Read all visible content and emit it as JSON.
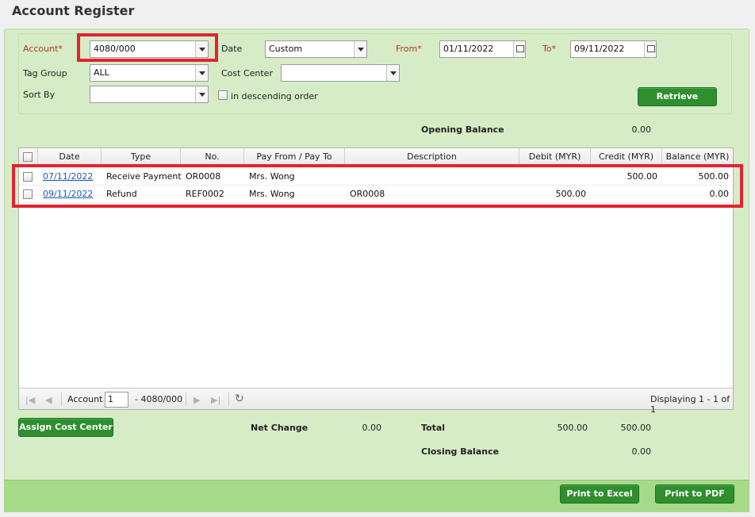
{
  "page": {
    "title": "Account Register"
  },
  "filters": {
    "account_label": "Account*",
    "account_value": "4080/000",
    "date_label": "Date",
    "date_value": "Custom",
    "from_label": "From*",
    "from_value": "01/11/2022",
    "to_label": "To*",
    "to_value": "09/11/2022",
    "tag_group_label": "Tag Group",
    "tag_group_value": "ALL",
    "cost_center_label": "Cost Center",
    "cost_center_value": "",
    "sort_by_label": "Sort By",
    "sort_by_value": "",
    "descending_label": "in descending order",
    "retrieve_label": "Retrieve"
  },
  "opening": {
    "label": "Opening Balance",
    "value": "0.00"
  },
  "table": {
    "headers": [
      "Date",
      "Type",
      "No.",
      "Pay From / Pay To",
      "Description",
      "Debit (MYR)",
      "Credit (MYR)",
      "Balance (MYR)"
    ],
    "rows": [
      {
        "date": "07/11/2022",
        "type": "Receive Payment",
        "no": "OR0008",
        "party": "Mrs. Wong",
        "description": "",
        "debit": "",
        "credit": "500.00",
        "balance": "500.00"
      },
      {
        "date": "09/11/2022",
        "type": "Refund",
        "no": "REF0002",
        "party": "Mrs. Wong",
        "description": "OR0008",
        "debit": "500.00",
        "credit": "",
        "balance": "0.00"
      }
    ]
  },
  "pager": {
    "label": "Account",
    "page": "1",
    "suffix": "- 4080/000",
    "display": "Displaying 1 - 1 of 1"
  },
  "summary": {
    "assign_label": "Assign Cost Center",
    "net_change_label": "Net Change",
    "net_change_value": "0.00",
    "total_label": "Total",
    "total_debit": "500.00",
    "total_credit": "500.00",
    "closing_label": "Closing Balance",
    "closing_value": "0.00"
  },
  "footer": {
    "excel_label": "Print to Excel",
    "pdf_label": "Print to PDF"
  },
  "colors": {
    "panel": "#d6ecc6",
    "footer": "#a6d98a",
    "button": "#2f8f2f",
    "highlight": "#e3232f",
    "required_label": "#b03a1a",
    "link": "#1a5bb8"
  }
}
